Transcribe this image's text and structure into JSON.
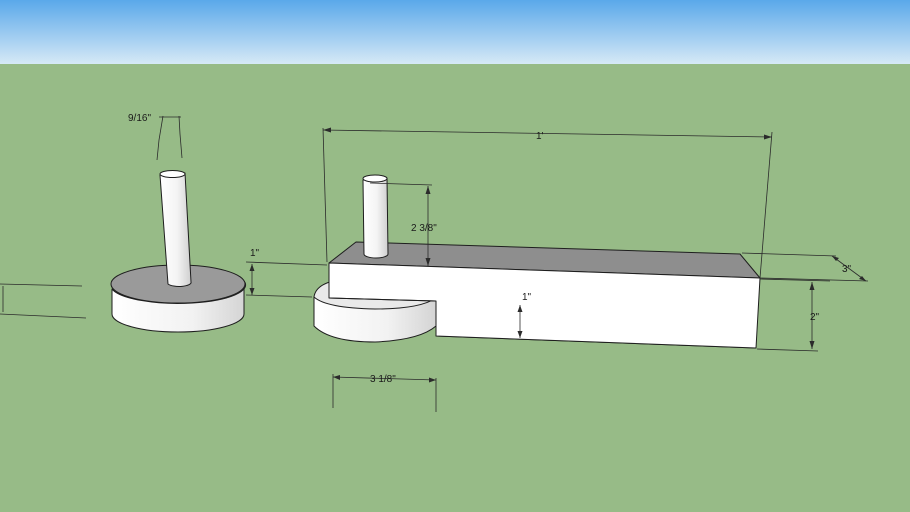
{
  "scene": {
    "colors": {
      "sky_top": "#5aa8ea",
      "sky_bottom": "#d6e9f6",
      "ground": "#97bb87",
      "face_light": "#ffffff",
      "face_shade": "#e6e6e6",
      "face_dark": "#8e8e8e"
    },
    "dimensions": {
      "pin_diameter_left": "9/16\"",
      "overall_length": "1'",
      "pin_height": "2 3/8\"",
      "block_width": "3\"",
      "block_height": "2\"",
      "plate_thickness_left": "1\"",
      "plate_thickness_right": "1\"",
      "knuckle_radius": "3 1/8\""
    }
  }
}
